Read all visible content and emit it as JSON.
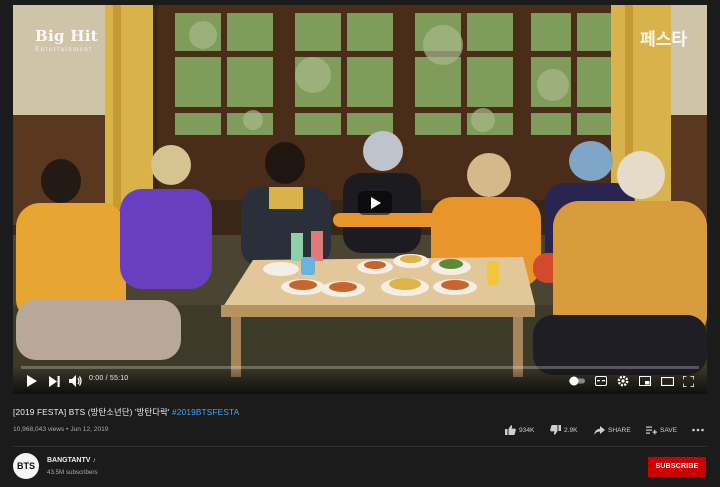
{
  "video": {
    "watermark_left": "Big Hit",
    "watermark_left_sub": "Entertainment",
    "watermark_right": "페스타",
    "time_display": "0:00 / 55:10",
    "progress": 0.0
  },
  "controls": {
    "left": [
      "play-icon",
      "next-icon",
      "volume-icon"
    ],
    "right": [
      "autoplay-toggle",
      "subtitles-icon",
      "settings-gear-icon",
      "miniplayer-icon",
      "theater-icon",
      "fullscreen-icon"
    ]
  },
  "info": {
    "title_text": "[2019 FESTA] BTS (방탄소년단) '방탄다락' ",
    "title_hashtag": "#2019BTSFESTA",
    "views": "10,968,043 views",
    "separator": " • ",
    "date": "Jun 12, 2019",
    "likes": "934K",
    "dislikes": "2.9K",
    "share_label": "SHARE",
    "save_label": "SAVE",
    "more_icon": "more-horizontal-icon"
  },
  "channel": {
    "avatar_text": "BTS",
    "name": "BANGTANTV",
    "note": "♪",
    "subscribers": "43.5M subscribers",
    "subscribe_label": "SUBSCRIBE"
  },
  "colors": {
    "background": "#1b1b1b",
    "hashtag": "#3ea6ff",
    "subscribe": "#cc0000",
    "secondary_text": "#aaaaaa"
  }
}
